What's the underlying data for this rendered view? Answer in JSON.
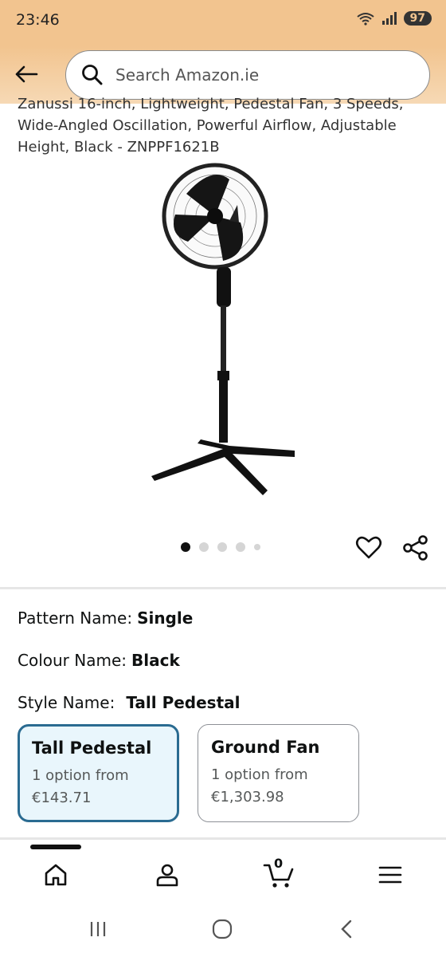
{
  "status_bar": {
    "time": "23:46",
    "battery": "97",
    "wifi_label": "6"
  },
  "header": {
    "search_placeholder": "Search Amazon.ie"
  },
  "product": {
    "title": "Zanussi 16-inch, Lightweight, Pedestal Fan, 3 Speeds, Wide-Angled Oscillation, Powerful Airflow, Adjustable Height, Black - ZNPPF1621B"
  },
  "carousel": {
    "count": 5,
    "active_index": 0
  },
  "variations": {
    "pattern": {
      "label": "Pattern Name:",
      "value": "Single"
    },
    "colour": {
      "label": "Colour Name:",
      "value": "Black"
    },
    "style": {
      "label": "Style Name:",
      "value": "Tall Pedestal"
    }
  },
  "style_options": [
    {
      "name": "Tall Pedestal",
      "line1": "1 option from",
      "price": "€143.71",
      "selected": true
    },
    {
      "name": "Ground Fan",
      "line1": "1 option from",
      "price": "€1,303.98",
      "selected": false
    }
  ],
  "bottom_nav": {
    "items": [
      {
        "name": "home",
        "icon": "home-icon"
      },
      {
        "name": "account",
        "icon": "person-icon"
      },
      {
        "name": "cart",
        "icon": "cart-icon",
        "count": "0"
      },
      {
        "name": "menu",
        "icon": "hamburger-icon"
      }
    ]
  },
  "colors": {
    "header_bg": "#f2c48f",
    "selected_border": "#2a6b91",
    "selected_bg": "#e9f6fc"
  }
}
